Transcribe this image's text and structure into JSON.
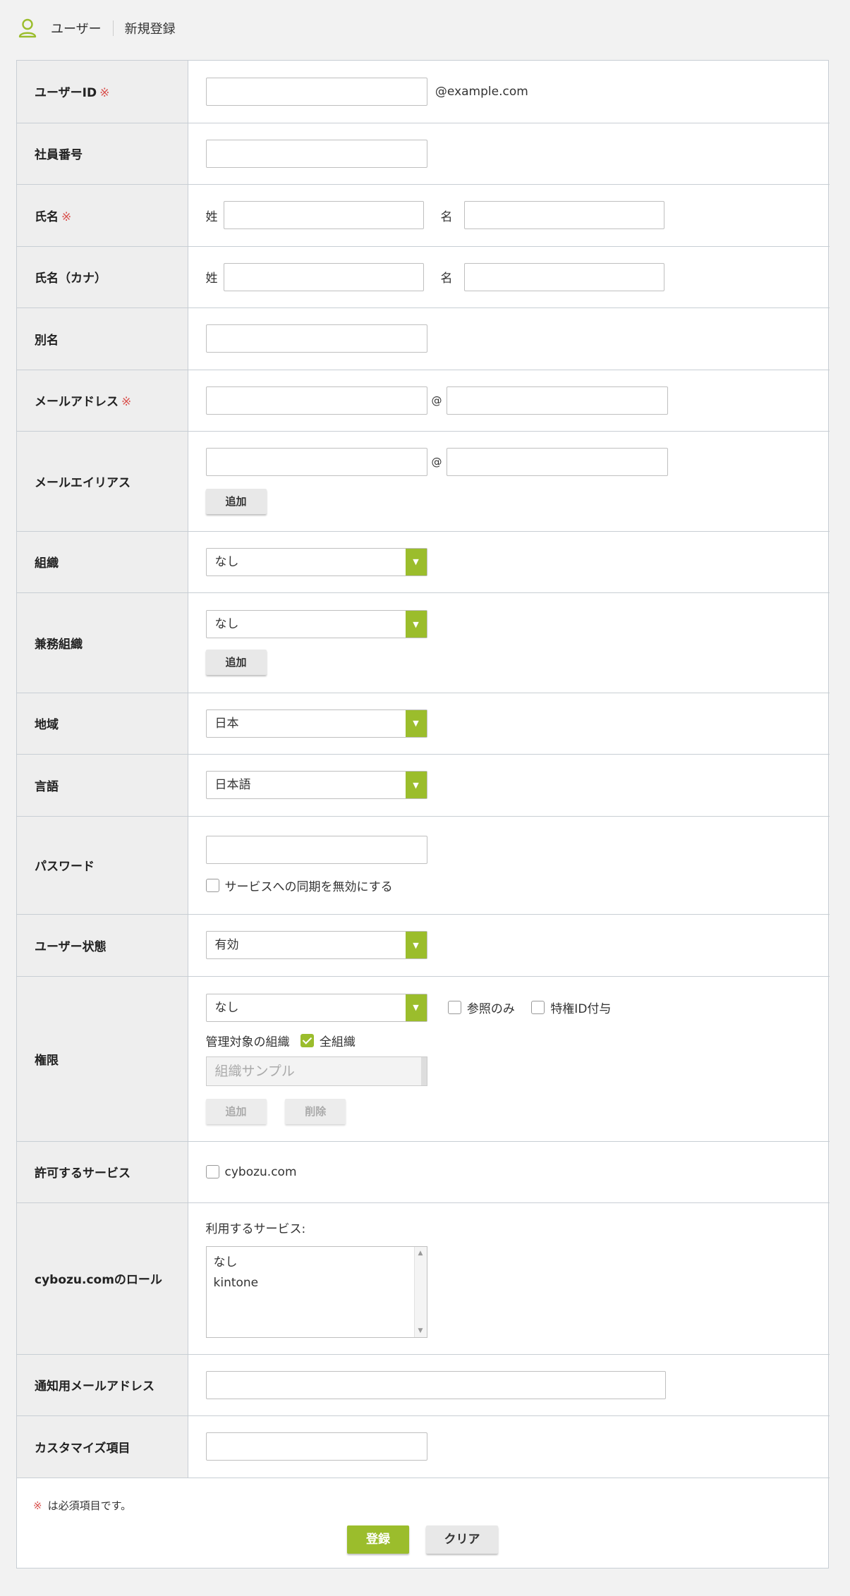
{
  "header": {
    "section": "ユーザー",
    "page": "新規登録",
    "icon": "user-icon",
    "accent": "#9bbd2c"
  },
  "required_mark": "※",
  "fields": {
    "user_id": {
      "label": "ユーザーID",
      "suffix": "@example.com"
    },
    "employee_no": {
      "label": "社員番号"
    },
    "name": {
      "label": "氏名",
      "last": "姓",
      "first": "名"
    },
    "name_kana": {
      "label": "氏名（カナ）",
      "last": "姓",
      "first": "名"
    },
    "alias": {
      "label": "別名"
    },
    "email": {
      "label": "メールアドレス",
      "at": "@"
    },
    "email_alias": {
      "label": "メールエイリアス",
      "at": "@",
      "add_button": "追加"
    },
    "organization": {
      "label": "組織",
      "value": "なし"
    },
    "secondary_org": {
      "label": "兼務組織",
      "value": "なし",
      "add_button": "追加"
    },
    "region": {
      "label": "地域",
      "value": "日本"
    },
    "language": {
      "label": "言語",
      "value": "日本語"
    },
    "password": {
      "label": "パスワード",
      "checkbox": "サービスへの同期を無効にする"
    },
    "status": {
      "label": "ユーザー状態",
      "value": "有効"
    },
    "permission": {
      "label": "権限",
      "value": "なし",
      "read_only": "参照のみ",
      "privileged_id": "特権ID付与",
      "managed_org_label": "管理対象の組織",
      "all_orgs": "全組織",
      "org_placeholder": "組織サンプル",
      "add_button": "追加",
      "delete_button": "削除"
    },
    "allowed_services": {
      "label": "許可するサービス",
      "checkbox": "cybozu.com"
    },
    "cybozu_role": {
      "label": "cybozu.comのロール",
      "services_label": "利用するサービス:",
      "options": [
        "なし",
        "kintone"
      ]
    },
    "notify_email": {
      "label": "通知用メールアドレス"
    },
    "custom": {
      "label": "カスタマイズ項目"
    }
  },
  "footer": {
    "note": "は必須項目です。",
    "submit": "登録",
    "clear": "クリア"
  }
}
